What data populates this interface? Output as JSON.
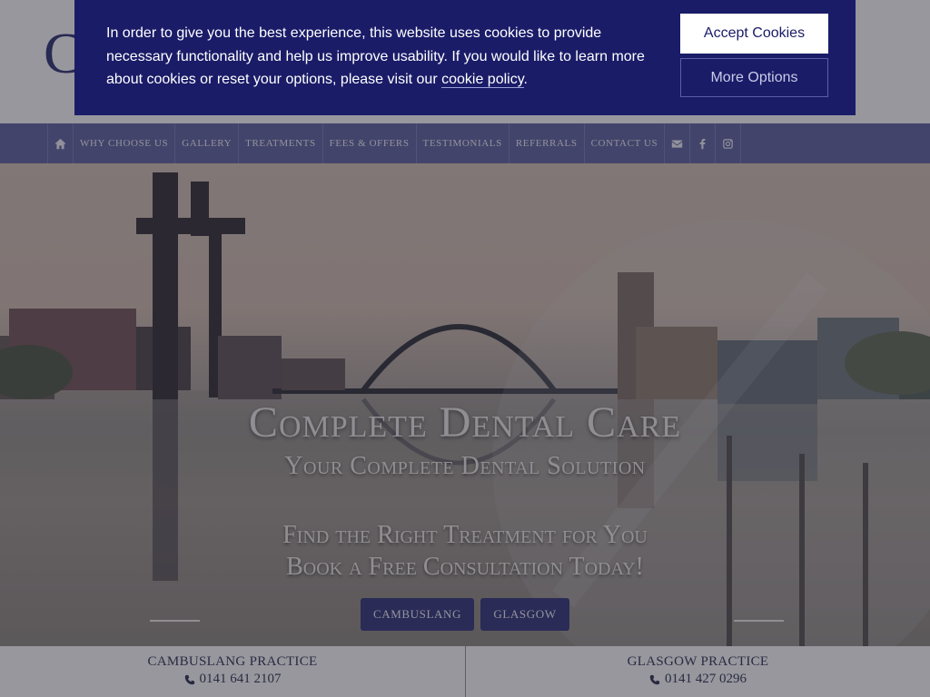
{
  "header": {
    "logo_letter": "C"
  },
  "nav": {
    "home_icon": "home-icon",
    "items": [
      {
        "label": "Why Choose Us"
      },
      {
        "label": "Gallery"
      },
      {
        "label": "Treatments"
      },
      {
        "label": "Fees & Offers"
      },
      {
        "label": "Testimonials"
      },
      {
        "label": "Referrals"
      },
      {
        "label": "Contact Us"
      }
    ],
    "social_icons": [
      "envelope-icon",
      "facebook-icon",
      "instagram-icon"
    ]
  },
  "hero": {
    "title": "Complete Dental Care",
    "subtitle": "Your Complete Dental Solution",
    "cta_line1": "Find the Right Treatment for You",
    "cta_line2": "Book a Free Consultation Today!",
    "buttons": [
      {
        "label": "Cambuslang"
      },
      {
        "label": "Glasgow"
      }
    ]
  },
  "footer": {
    "practices": [
      {
        "name": "Cambuslang Practice",
        "phone": "0141 641 2107"
      },
      {
        "name": "Glasgow Practice",
        "phone": "0141 427 0296"
      }
    ]
  },
  "cookie_banner": {
    "text_before_link": "In order to give you the best experience, this website uses cookies to provide necessary functionality and help us improve usability. If you would like to learn more about cookies or reset your options, please visit our ",
    "link_text": "cookie policy",
    "text_after_link": ".",
    "accept_label": "Accept Cookies",
    "more_label": "More Options"
  },
  "colors": {
    "brand_navy": "#1a1c68",
    "nav_bg": "#5a5c9a",
    "button_bg": "#2d2f74"
  }
}
